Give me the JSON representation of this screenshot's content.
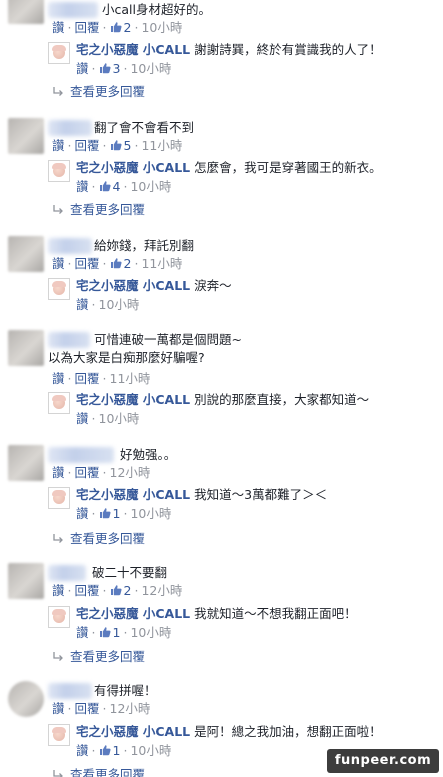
{
  "ui": {
    "like": "讚",
    "reply": "回覆",
    "dot": "·",
    "see_more": "查看更多回覆"
  },
  "reply_author": "宅之小惡魔 小CALL",
  "threads": [
    {
      "comment": "小call身材超好的。",
      "likes": "2",
      "time": "10小時",
      "reply": {
        "text": "謝謝詩巽，終於有賞識我的人了！",
        "likes": "3",
        "time": "10小時"
      },
      "has_more": true
    },
    {
      "comment": "翻了會不會看不到",
      "likes": "5",
      "time": "11小時",
      "reply": {
        "text": "怎麼會，我可是穿著國王的新衣。",
        "likes": "4",
        "time": "10小時"
      },
      "has_more": true
    },
    {
      "comment": "給妳錢，拜託別翻",
      "likes": "2",
      "time": "11小時",
      "reply": {
        "text": "淚奔～",
        "likes": "",
        "time": "10小時"
      },
      "has_more": false
    },
    {
      "comment": "可惜連破一萬都是個問題~",
      "comment2": "以為大家是白痴那麼好騙喔?",
      "likes": "",
      "time": "11小時",
      "reply": {
        "text": "別說的那麼直接，大家都知道～",
        "likes": "",
        "time": "10小時"
      },
      "has_more": false
    },
    {
      "comment": "好勉强。。",
      "likes": "",
      "time": "12小時",
      "reply": {
        "text": "我知道～3萬都難了＞＜",
        "likes": "1",
        "time": "10小時"
      },
      "has_more": true
    },
    {
      "comment": "破二十不要翻",
      "likes": "2",
      "time": "12小時",
      "reply": {
        "text": "我就知道～不想我翻正面吧！",
        "likes": "1",
        "time": "10小時"
      },
      "has_more": true
    },
    {
      "comment": "有得拼喔！",
      "likes": "",
      "time": "12小時",
      "reply": {
        "text": "是阿！總之我加油，想翻正面啦！",
        "likes": "1",
        "time": "10小時"
      },
      "has_more": true
    }
  ],
  "watermark": "funpeer.com",
  "colors": {
    "link": "#365899",
    "meta": "#90949c",
    "text": "#1d2129"
  }
}
